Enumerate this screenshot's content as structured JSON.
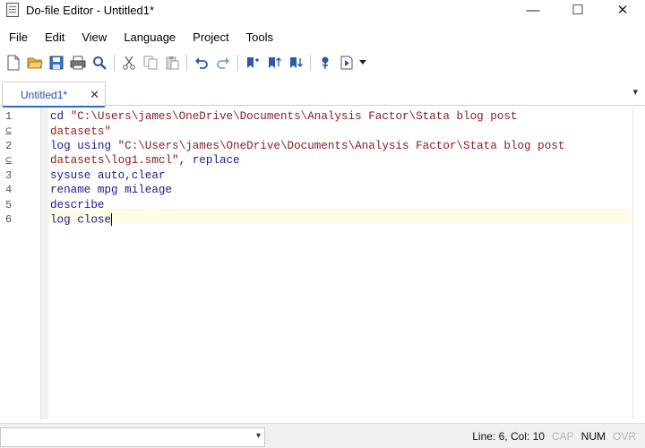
{
  "window": {
    "title": "Do-file Editor - Untitled1*",
    "minimize": "—",
    "maximize": "☐",
    "close": "✕"
  },
  "menu": [
    "File",
    "Edit",
    "View",
    "Language",
    "Project",
    "Tools"
  ],
  "toolbar": {
    "icons": [
      "new-file-icon",
      "open-folder-icon",
      "save-icon",
      "print-icon",
      "find-icon",
      "cut-icon",
      "copy-icon",
      "paste-icon",
      "undo-icon",
      "redo-icon",
      "toggle-bookmark-icon",
      "previous-bookmark-icon",
      "next-bookmark-icon",
      "show-file-in-viewer-icon",
      "execute-do-icon",
      "dropdown-arrow-icon"
    ]
  },
  "tabs": [
    {
      "label": "Untitled1*",
      "close": "✕"
    }
  ],
  "tab_menu": "▾",
  "editor": {
    "lines": [
      {
        "num": "1",
        "kw": "cd ",
        "str": "\"C:\\Users\\james\\OneDrive\\Documents\\Analysis Factor\\Stata blog post",
        "rest": ""
      },
      {
        "num": "⊆",
        "kw": "",
        "str": "datasets\"",
        "rest": ""
      },
      {
        "num": "2",
        "kw": "log using ",
        "str": "\"C:\\Users\\james\\OneDrive\\Documents\\Analysis Factor\\Stata blog post",
        "rest": ""
      },
      {
        "num": "⊆",
        "kw": "",
        "str": "datasets\\log1.smcl\"",
        "rest": ", replace"
      },
      {
        "num": "3",
        "kw": "sysuse auto,clear",
        "str": "",
        "rest": ""
      },
      {
        "num": "4",
        "kw": "rename mpg mileage",
        "str": "",
        "rest": ""
      },
      {
        "num": "5",
        "kw": "describe",
        "str": "",
        "rest": ""
      },
      {
        "num": "6",
        "kw": "log close",
        "str": "",
        "rest": ""
      }
    ]
  },
  "status": {
    "position": "Line: 6, Col: 10",
    "cap": "CAP",
    "num": "NUM",
    "ovr": "OVR",
    "combo_arrow": "▾"
  },
  "colors": {
    "keyword": "#1a1a8c",
    "string": "#8b1a1a",
    "active_tab": "#2b6bd6",
    "current_line": "#fffbe6"
  }
}
